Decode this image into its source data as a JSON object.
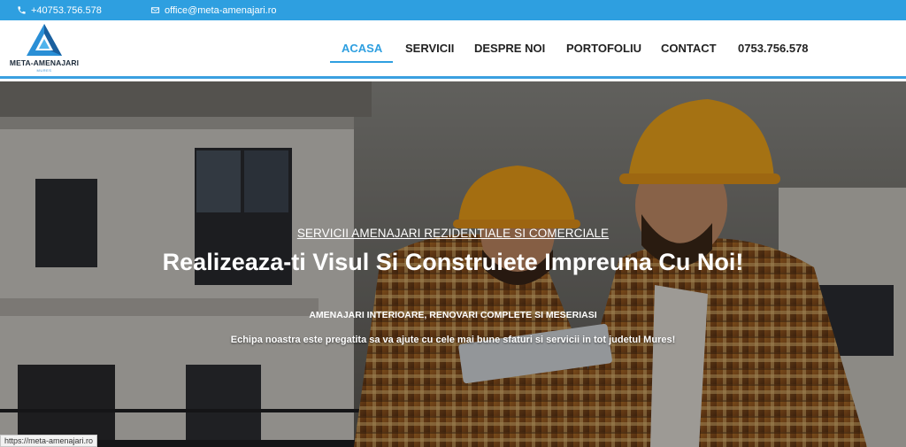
{
  "topbar": {
    "phone": "+40753.756.578",
    "email": "office@meta-amenajari.ro",
    "phone_icon": "phone-icon",
    "email_icon": "envelope-icon"
  },
  "logo": {
    "name": "META-AMENAJARI",
    "sub": "MURES"
  },
  "nav": {
    "items": [
      "ACASA",
      "SERVICII",
      "DESPRE NOI",
      "PORTOFOLIU",
      "CONTACT",
      "0753.756.578"
    ],
    "active": "ACASA"
  },
  "hero": {
    "subtitle": "SERVICII AMENAJARI REZIDENTIALE SI COMERCIALE",
    "headline": "Realizeaza-ti Visul Si Construiete Impreuna Cu Noi!",
    "services": "AMENAJARI INTERIOARE, RENOVARI COMPLETE SI MESERIASI",
    "tagline": "Echipa noastra este pregatita sa va ajute cu cele mai bune sfaturi si servicii in tot judetul Mures!"
  },
  "statusbar": {
    "url": "https://meta-amenajari.ro"
  },
  "colors": {
    "accent": "#2e9fe0",
    "nav_text": "#222222",
    "white": "#ffffff"
  }
}
